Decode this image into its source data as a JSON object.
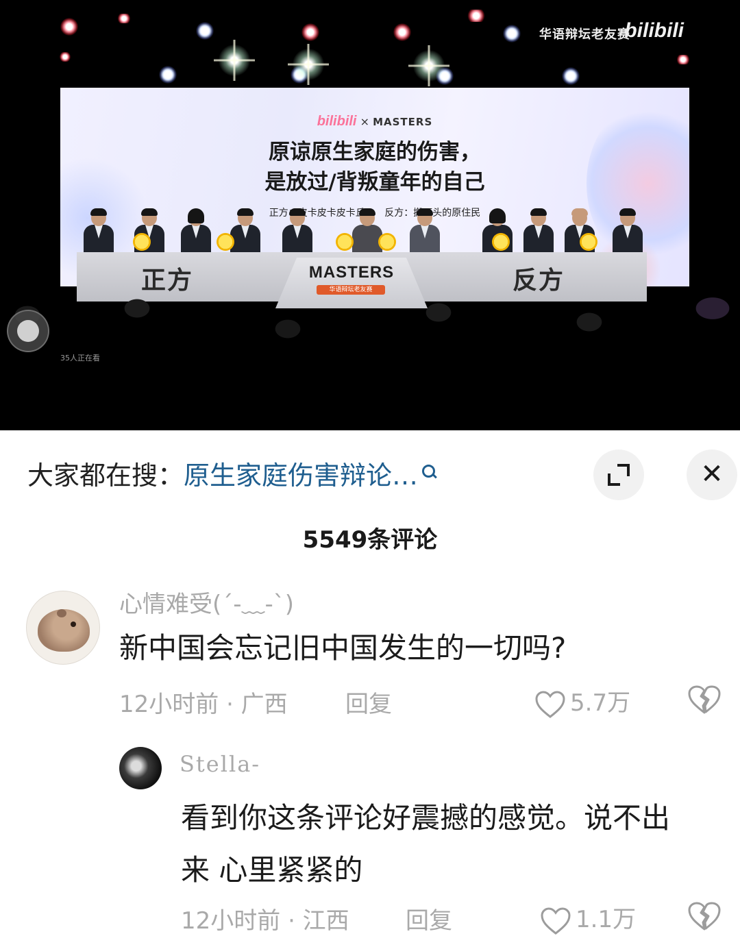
{
  "video": {
    "watermark_text": "华语辩坛老友赛",
    "watermark_logo": "bilibili",
    "screen_logo_left": "bilibili",
    "screen_logo_x": "×",
    "screen_logo_right": "MASTERS",
    "motion_line1": "原谅原生家庭的伤害，",
    "motion_line2": "是放过/背叛童年的自己",
    "affirmative_side": "正方：皮卡皮卡皮卡丘",
    "negative_side": "反方：搬石头的原住民",
    "desk_left": "正方",
    "desk_right": "反方",
    "center_logo": "MASTERS",
    "center_sub": "华语辩坛老友赛",
    "viewers": "35人正在看"
  },
  "panel": {
    "search_prefix": "大家都在搜：",
    "search_query": "原生家庭伤害辩论…",
    "comment_count": "5549条评论"
  },
  "comments": [
    {
      "username": "心情难受(´-﹏-`)",
      "text": "新中国会忘记旧中国发生的一切吗?",
      "time_location": "12小时前 · 广西",
      "reply_label": "回复",
      "likes": "5.7万"
    },
    {
      "username": "Stella-",
      "text_line1": "看到你这条评论好震撼的感觉。说不出",
      "text_line2": "来 心里紧紧的",
      "time_location": "12小时前 · 江西",
      "reply_label": "回复",
      "likes": "1.1万"
    }
  ],
  "icons": [
    "search-icon",
    "expand-icon",
    "close-icon",
    "heart-icon",
    "broken-heart-icon",
    "record-icon"
  ],
  "colors": {
    "link": "#1f5e8f",
    "muted": "#a9a9a9",
    "text": "#1b1b1b"
  }
}
